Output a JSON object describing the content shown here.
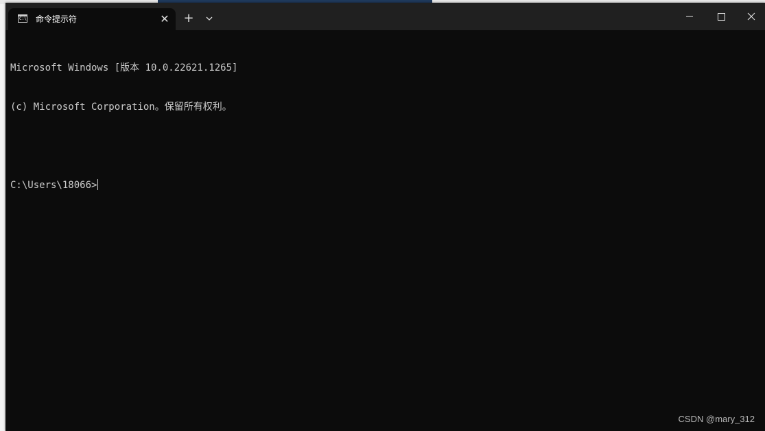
{
  "window": {
    "tab_title": "命令提示符",
    "new_tab_label": "+",
    "tab_close_label": "✕"
  },
  "console": {
    "lines": [
      "Microsoft Windows [版本 10.0.22621.1265]",
      "(c) Microsoft Corporation。保留所有权利。",
      "",
      "C:\\Users\\18066>"
    ]
  },
  "watermark": "CSDN @mary_312",
  "icons": {
    "tab_icon": "cmd-icon",
    "dropdown": "chevron-down-icon",
    "minimize": "minimize-icon",
    "maximize": "maximize-icon",
    "close": "close-icon"
  },
  "colors": {
    "console_bg": "#0c0c0c",
    "titlebar_bg": "#202020",
    "text": "#cccccc"
  }
}
